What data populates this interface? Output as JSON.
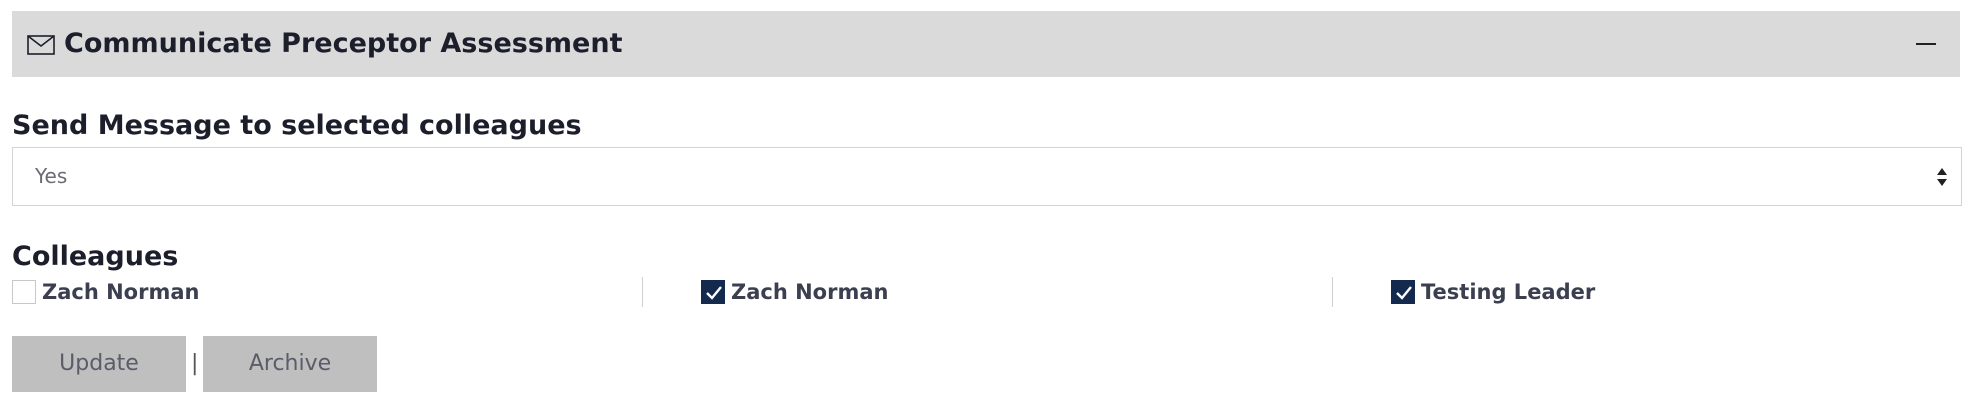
{
  "panel": {
    "title": "Communicate Preceptor Assessment",
    "icon": "envelope-icon",
    "collapse_icon": "minus-icon"
  },
  "send_message": {
    "label": "Send Message to selected colleagues",
    "selected_value": "Yes"
  },
  "colleagues": {
    "label": "Colleagues",
    "items": [
      {
        "name": "Zach Norman",
        "checked": false
      },
      {
        "name": "Zach Norman",
        "checked": true
      },
      {
        "name": "Testing Leader",
        "checked": true
      }
    ]
  },
  "actions": {
    "update_label": "Update",
    "separator": "|",
    "archive_label": "Archive"
  },
  "colors": {
    "header_bg": "#dadada",
    "checkbox_checked": "#14294e",
    "button_bg": "#bfbfbf"
  }
}
